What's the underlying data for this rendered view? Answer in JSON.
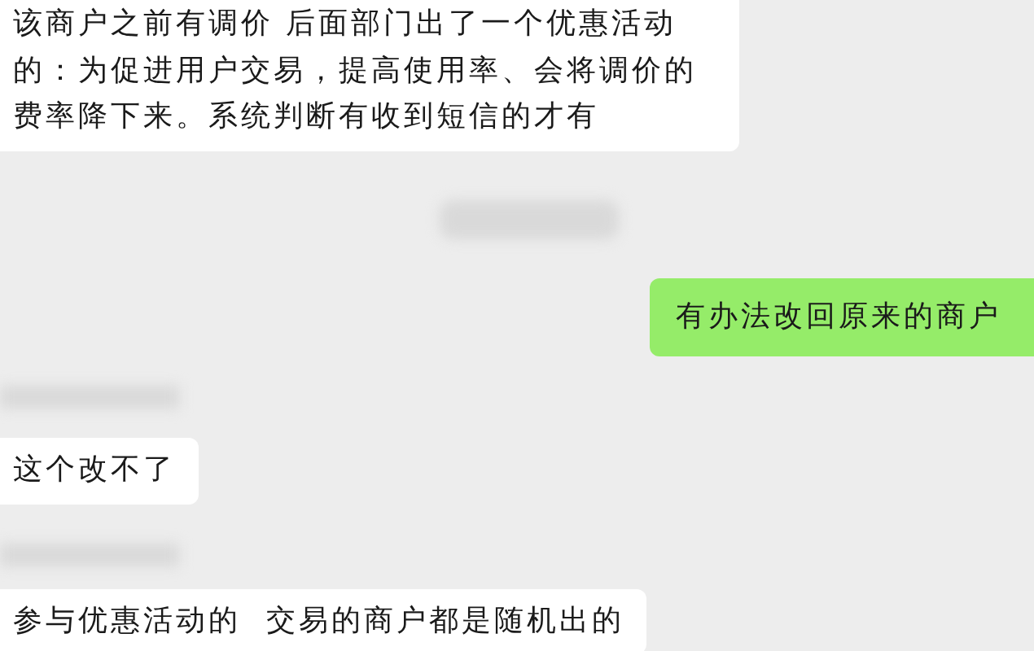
{
  "messages": [
    {
      "kind": "incoming",
      "text": "该商户之前有调价 后面部门出了一个优惠活动的：为促进用户交易，提高使用率、会将调价的费率降下来。系统判断有收到短信的才有"
    },
    {
      "kind": "redacted-time"
    },
    {
      "kind": "outgoing",
      "text": "有办法改回原来的商户"
    },
    {
      "kind": "redacted-name"
    },
    {
      "kind": "incoming",
      "text": "这个改不了"
    },
    {
      "kind": "redacted-name"
    },
    {
      "kind": "incoming",
      "text": "参与优惠活动的  交易的商户都是随机出的"
    }
  ]
}
